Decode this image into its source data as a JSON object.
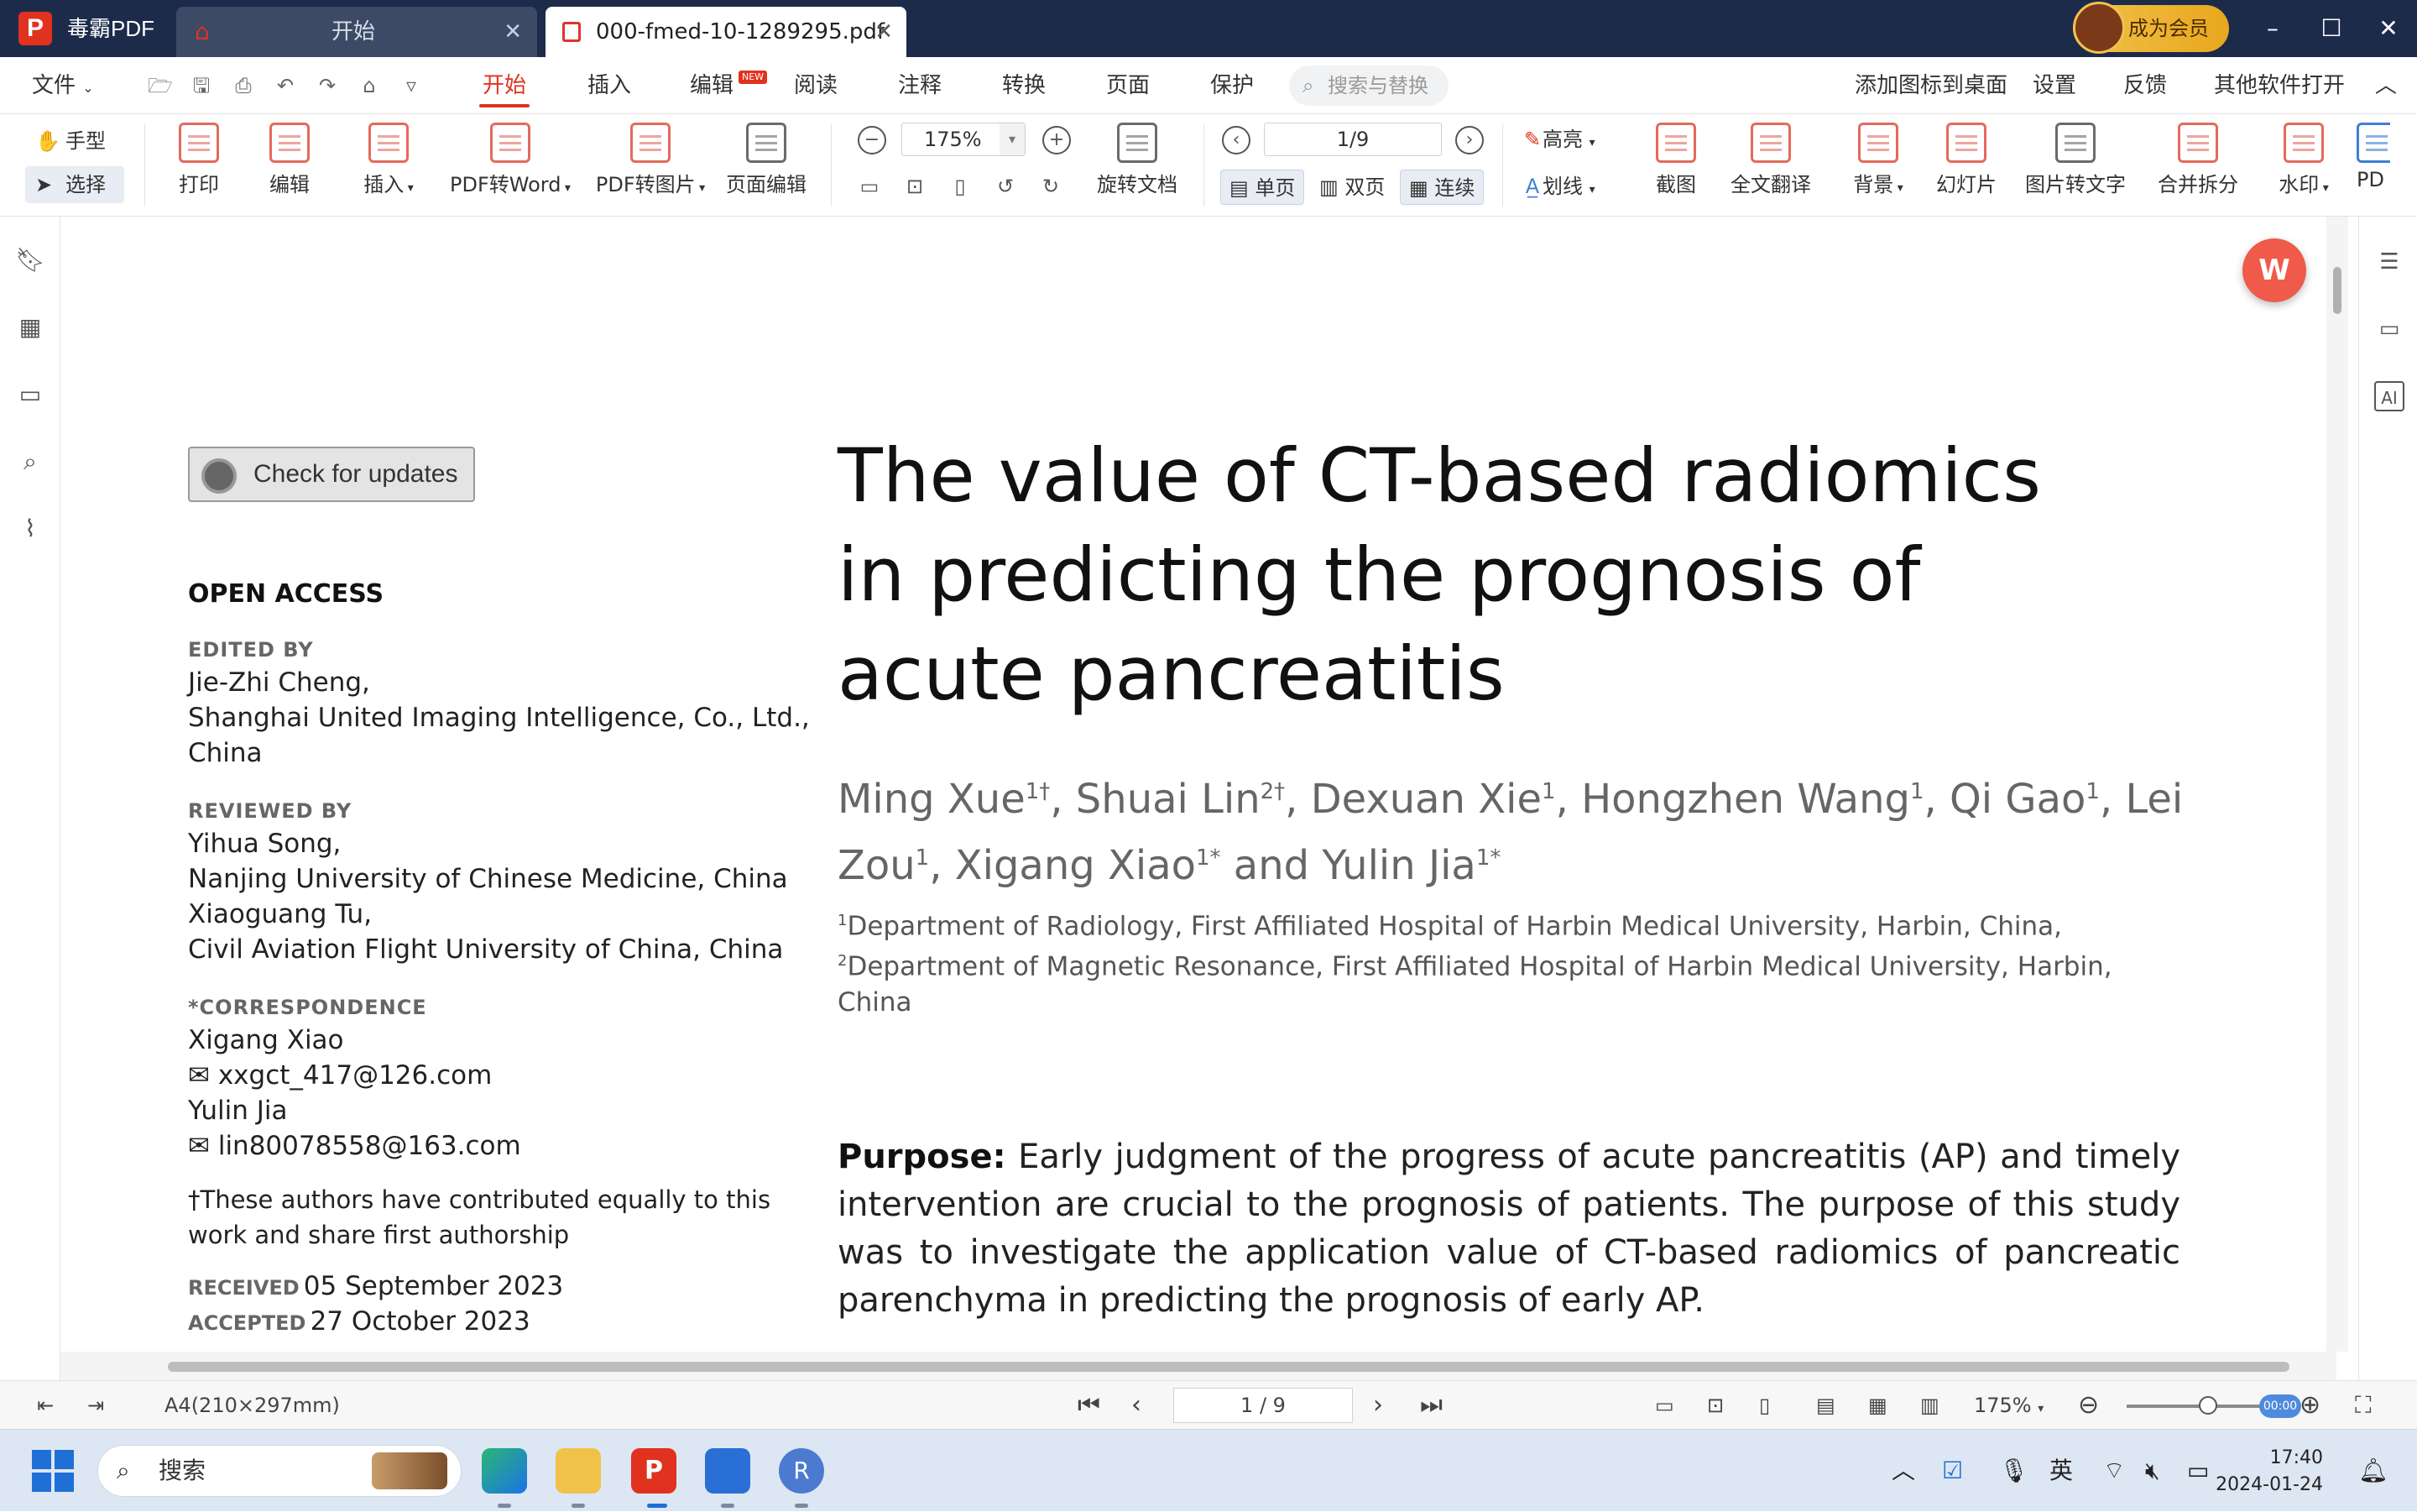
{
  "titlebar": {
    "app_name": "毒霸PDF",
    "tabs": [
      {
        "label": "开始"
      },
      {
        "label": "000-fmed-10-1289295.pdf"
      }
    ],
    "member_button": "成为会员"
  },
  "menubar": {
    "file": "文件",
    "items": [
      "开始",
      "插入",
      "编辑",
      "阅读",
      "注释",
      "转换",
      "页面",
      "保护"
    ],
    "new_badge": "NEW",
    "search_placeholder": "搜索与替换",
    "right_items": [
      "添加图标到桌面",
      "设置",
      "反馈",
      "其他软件打开"
    ]
  },
  "ribbon": {
    "hand": "手型",
    "select": "选择",
    "buttons": [
      "打印",
      "编辑",
      "插入",
      "PDF转Word",
      "PDF转图片",
      "页面编辑"
    ],
    "zoom_value": "175%",
    "rotate": "旋转文档",
    "page_value": "1/9",
    "view_single": "单页",
    "view_double": "双页",
    "view_continuous": "连续",
    "highlight": "高亮",
    "strikeline": "划线",
    "right_buttons": [
      "截图",
      "全文翻译",
      "背景",
      "幻灯片",
      "图片转文字",
      "合并拆分",
      "水印",
      "PD"
    ]
  },
  "document": {
    "check_updates": "Check for updates",
    "open_access": "OPEN ACCESS",
    "edited_by_label": "EDITED BY",
    "edited_by": [
      "Jie-Zhi Cheng,",
      "Shanghai United Imaging Intelligence, Co., Ltd.,",
      "China"
    ],
    "reviewed_by_label": "REVIEWED BY",
    "reviewed_by": [
      "Yihua Song,",
      "Nanjing University of Chinese Medicine, China",
      "Xiaoguang Tu,",
      "Civil Aviation Flight University of China, China"
    ],
    "correspondence_label": "*CORRESPONDENCE",
    "correspondence": [
      "Xigang Xiao",
      "✉ xxgct_417@126.com",
      "Yulin Jia",
      "✉ lin80078558@163.com"
    ],
    "equal_contribution": [
      "†These authors have contributed equally to this",
      "work and share first authorship"
    ],
    "received_label": "RECEIVED",
    "received": "05 September 2023",
    "accepted_label": "ACCEPTED",
    "accepted": "27 October 2023",
    "title_lines": [
      "The value of CT-based radiomics",
      "in predicting the prognosis of",
      "acute pancreatitis"
    ],
    "authors": [
      {
        "name": "Ming Xue",
        "sup": "1†"
      },
      {
        "name": ", Shuai Lin",
        "sup": "2†"
      },
      {
        "name": ", Dexuan Xie",
        "sup": "1"
      },
      {
        "name": ", Hongzhen Wang",
        "sup": "1"
      },
      {
        "name": ", Qi Gao",
        "sup": "1"
      },
      {
        "name": ", Lei Zou",
        "sup": "1"
      },
      {
        "name": ", Xigang Xiao",
        "sup": "1*"
      },
      {
        "name": " and Yulin Jia",
        "sup": "1*"
      }
    ],
    "affiliations": [
      {
        "sup": "1",
        "text": "Department of Radiology, First Affiliated Hospital of Harbin Medical University, Harbin, China,"
      },
      {
        "sup": "2",
        "text": "Department of Magnetic Resonance, First Affiliated Hospital of Harbin Medical University, Harbin, China"
      }
    ],
    "abstract_label": "Purpose:",
    "abstract_text": "Early judgment of the progress of acute pancreatitis (AP) and timely intervention are crucial to the prognosis of patients. The purpose of this study was to investigate the application value of CT-based radiomics of pancreatic parenchyma in predicting the prognosis of early AP."
  },
  "statusbar": {
    "page_size": "A4(210×297mm)",
    "page_value": "1 / 9",
    "zoom": "175%",
    "zoom_pill": "00:00"
  },
  "taskbar": {
    "search_placeholder": "搜索",
    "ime": "英",
    "time": "17:40",
    "date": "2024-01-24"
  }
}
